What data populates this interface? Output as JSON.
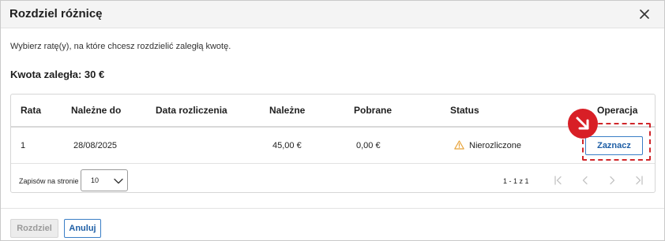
{
  "dialog": {
    "title": "Rozdziel różnicę",
    "instruction": "Wybierz ratę(y), na które chcesz rozdzielić zaległą kwotę.",
    "due_amount": "Kwota zaległa: 30 €"
  },
  "table": {
    "columns": [
      "Rata",
      "Należne do",
      "Data rozliczenia",
      "Należne",
      "Pobrane",
      "Status",
      "Operacja"
    ],
    "rows": [
      {
        "rata": "1",
        "nalezne_do": "28/08/2025",
        "data_rozliczenia": "",
        "nalezne": "45,00 €",
        "pobrane": "0,00 €",
        "status": "Nierozliczone",
        "status_icon": "warning-icon",
        "action_label": "Zaznacz"
      }
    ]
  },
  "pagination": {
    "per_page_label": "Zapisów na stronie",
    "per_page_value": "10",
    "range": "1 - 1 z 1"
  },
  "footer": {
    "distribute_label": "Rozdziel",
    "cancel_label": "Anuluj"
  },
  "colors": {
    "accent": "#1f5fa6",
    "highlight": "#d0262a",
    "warning": "#e8a33a"
  }
}
